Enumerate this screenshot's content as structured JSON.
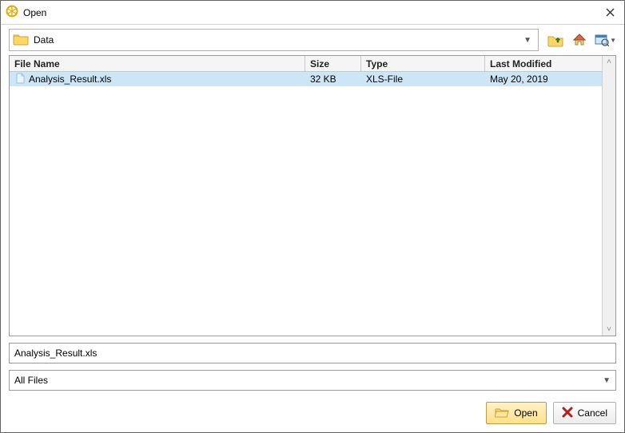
{
  "title": "Open",
  "location": {
    "folder": "Data"
  },
  "columns": {
    "name": "File Name",
    "size": "Size",
    "type": "Type",
    "mod": "Last Modified"
  },
  "files": [
    {
      "name": "Analysis_Result.xls",
      "size": "32 KB",
      "type": "XLS-File",
      "mod": "May 20, 2019",
      "selected": true
    }
  ],
  "filename": "Analysis_Result.xls",
  "filter": "All Files",
  "buttons": {
    "open": "Open",
    "cancel": "Cancel"
  }
}
